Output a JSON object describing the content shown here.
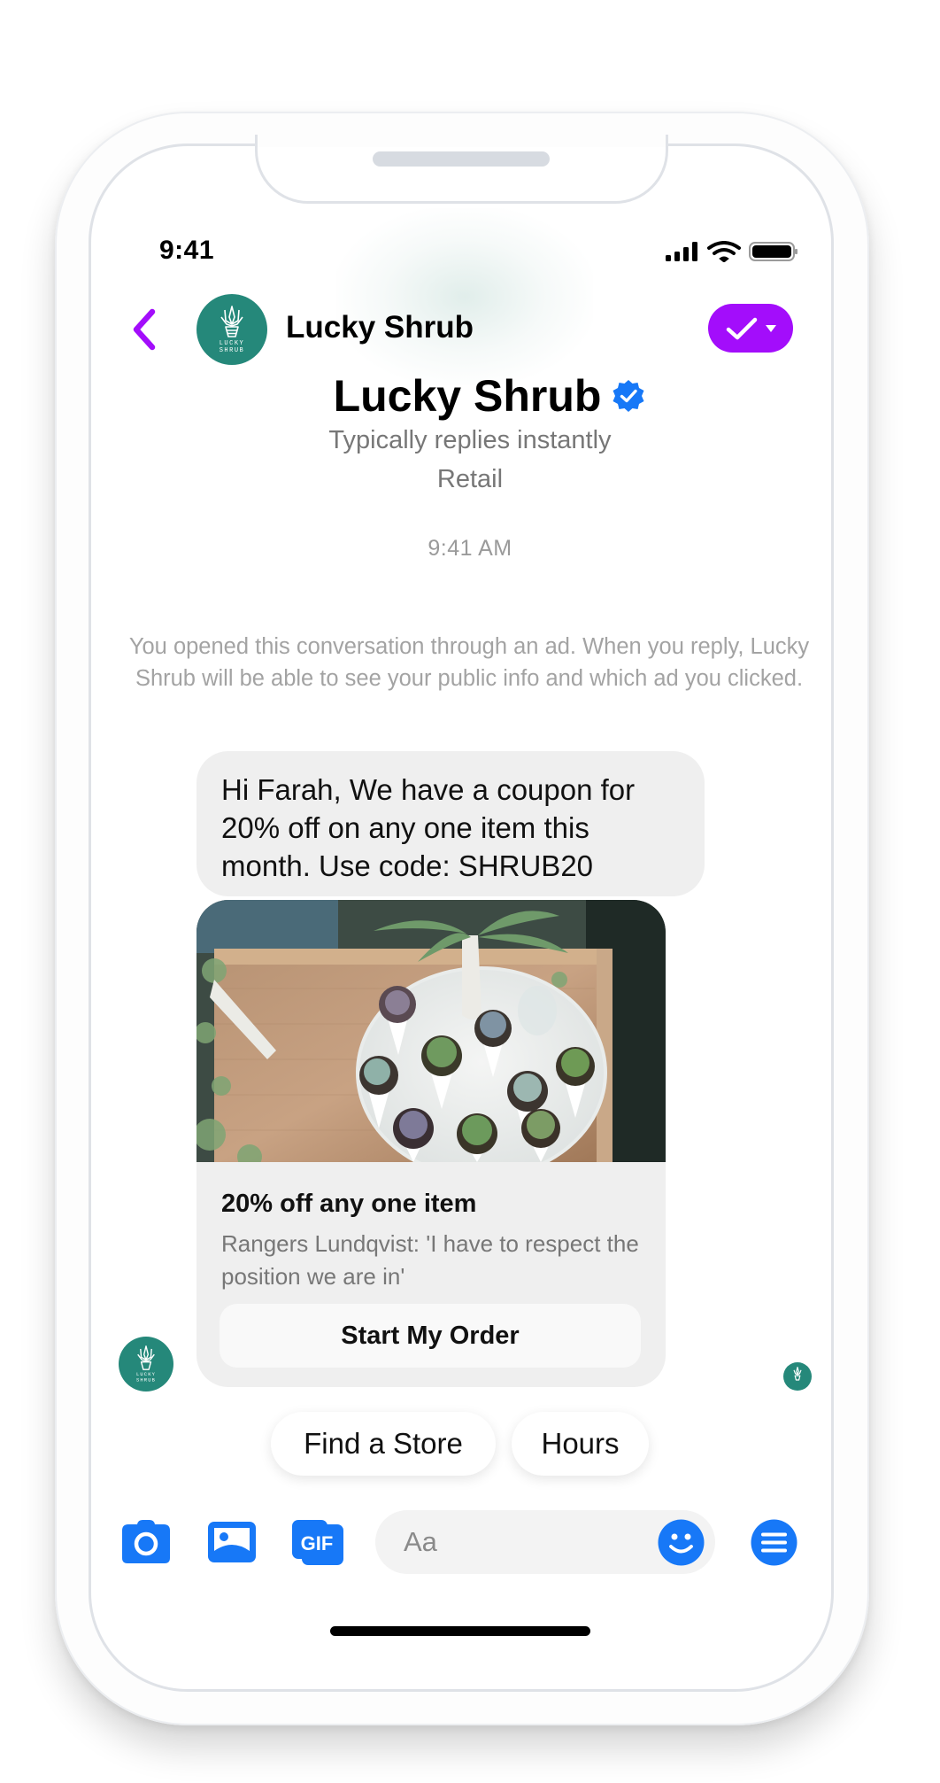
{
  "status_bar": {
    "time": "9:41",
    "icons": [
      "signal-icon",
      "wifi-icon",
      "battery-icon"
    ]
  },
  "header": {
    "back_icon": "chevron-left-icon",
    "avatar_text_line1": "LUCKY",
    "avatar_text_line2": "SHRUB",
    "name": "Lucky Shrub",
    "action_button_icon": "check-dropdown-icon"
  },
  "profile": {
    "title": "Lucky Shrub",
    "verified_icon": "verified-badge-icon",
    "response_time": "Typically replies instantly",
    "category": "Retail"
  },
  "conversation": {
    "timestamp": "9:41 AM",
    "ad_notice": "You opened this conversation through an ad. When you reply, Lucky Shrub will be able to see your public info and which ad you clicked.",
    "message": "Hi Farah, We have a coupon for 20% off on any one item this month. Use code: SHRUB20",
    "card": {
      "image_alt": "Succulents in white cone planters on a round tray",
      "title": "20% off any one item",
      "subtitle": "Rangers Lundqvist: 'I have to respect the position we are in'",
      "button_label": "Start My Order"
    }
  },
  "quick_replies": [
    {
      "label": "Find a Store"
    },
    {
      "label": "Hours"
    }
  ],
  "composer": {
    "placeholder": "Aa",
    "value": "",
    "tools": [
      "camera-icon",
      "photo-icon",
      "gif-icon"
    ],
    "emoji_icon": "emoji-icon",
    "menu_icon": "menu-icon"
  },
  "colors": {
    "accent_purple": "#a30dfb",
    "messenger_blue": "#1778f7",
    "brand_teal": "#25887a",
    "bubble_gray": "#efefef"
  }
}
